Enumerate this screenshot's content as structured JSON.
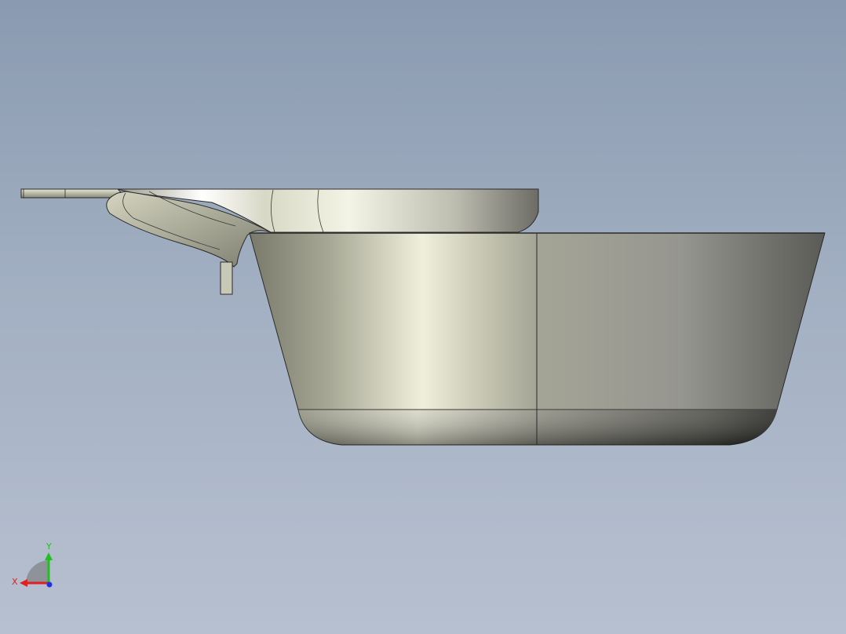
{
  "viewport": {
    "background_top": "#8a9ab0",
    "background_bottom": "#b7c0d0"
  },
  "model": {
    "name": "pan-side-view",
    "body_color": "#b4b4a2",
    "highlight_color": "#f2f2de",
    "shadow_color": "#4e4e48"
  },
  "triad": {
    "x_label": "X",
    "y_label": "Y",
    "x_color": "#e02020",
    "y_color": "#20c020",
    "z_color": "#2030e0"
  }
}
